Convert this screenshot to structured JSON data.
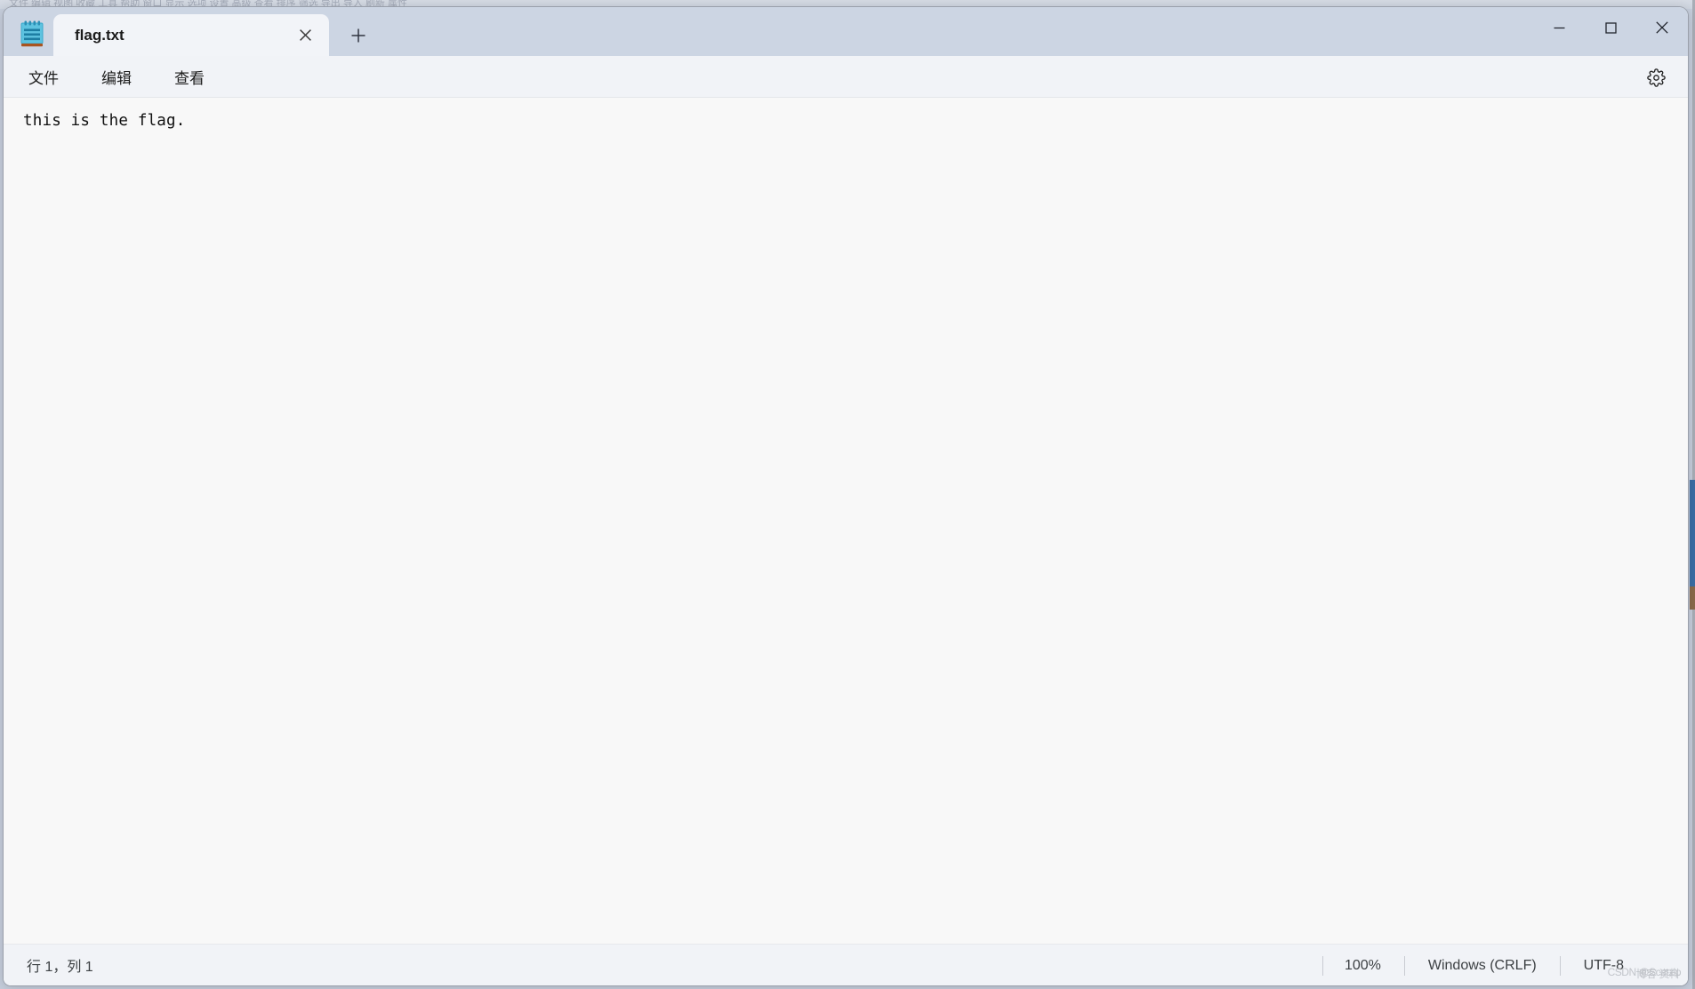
{
  "window": {
    "app_name": "Notepad",
    "app_icon": "notepad-icon",
    "controls": {
      "minimize": "minimize-icon",
      "maximize": "maximize-icon",
      "close": "close-icon"
    }
  },
  "tabs": {
    "items": [
      {
        "label": "flag.txt",
        "active": true,
        "close_icon": "close-icon"
      }
    ],
    "new_tab_icon": "plus-icon",
    "new_tab_label": "+"
  },
  "menubar": {
    "items": [
      {
        "label": "文件"
      },
      {
        "label": "编辑"
      },
      {
        "label": "查看"
      }
    ],
    "settings_icon": "gear-icon"
  },
  "editor": {
    "content": "this is the flag."
  },
  "statusbar": {
    "cursor_position": "行 1，列 1",
    "zoom": "100%",
    "line_ending": "Windows (CRLF)",
    "encoding": "UTF-8"
  },
  "watermark": {
    "text_a": "CSDN @Scatzlp",
    "text_b": "博客 资料"
  },
  "background": {
    "ghost_menu": "文件  编辑  视图  收藏  工具  帮助  窗口  显示  选项  设置  高级  查看  排序  筛选  导出  导入  刷新  属性"
  },
  "colors": {
    "titlebar": "#ccd5e3",
    "menubar": "#f1f3f7",
    "editor": "#f8f8f8",
    "tab_active": "#f2f4f8",
    "accent_blue": "#3a6ea5"
  }
}
